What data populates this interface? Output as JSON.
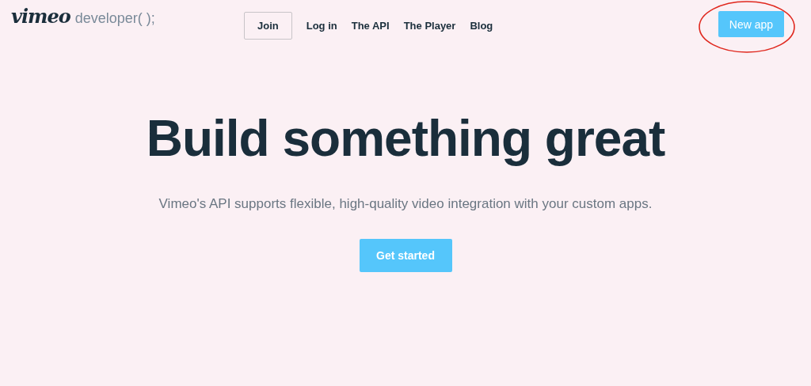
{
  "logo": {
    "wordmark": "vimeo",
    "suffix": "developer( );"
  },
  "nav": [
    {
      "label": "Join",
      "kind": "outlined"
    },
    {
      "label": "Log in",
      "kind": "plain"
    },
    {
      "label": "The API",
      "kind": "plain"
    },
    {
      "label": "The Player",
      "kind": "plain"
    },
    {
      "label": "Blog",
      "kind": "plain"
    }
  ],
  "new_app_button": {
    "label": "New app",
    "highlighted": true
  },
  "hero": {
    "title": "Build something great",
    "subtitle": "Vimeo's API supports flexible, high-quality video integration with your custom apps.",
    "button": "Get started"
  }
}
